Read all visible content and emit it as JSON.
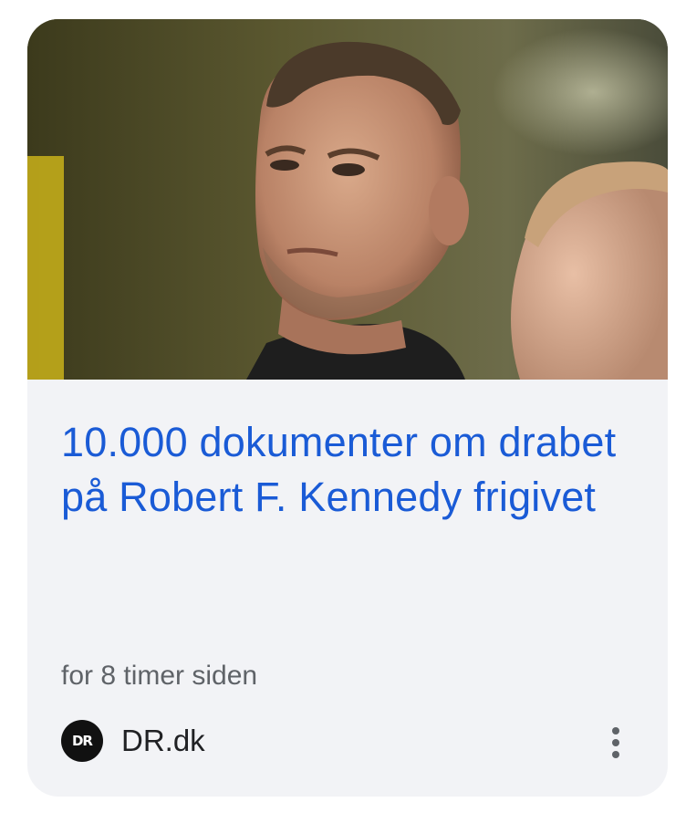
{
  "article": {
    "headline": "10.000 dokumenter om drabet på Robert F. Kennedy frigivet",
    "timestamp": "for 8 timer siden",
    "source": {
      "name": "DR.dk",
      "logo_text": "DR"
    }
  },
  "icons": {
    "more_menu": "more-vert-icon"
  },
  "colors": {
    "card_background": "#f2f3f6",
    "headline": "#1a5bd6",
    "timestamp": "#5f6368",
    "source_text": "#202124",
    "logo_background": "#111111"
  }
}
